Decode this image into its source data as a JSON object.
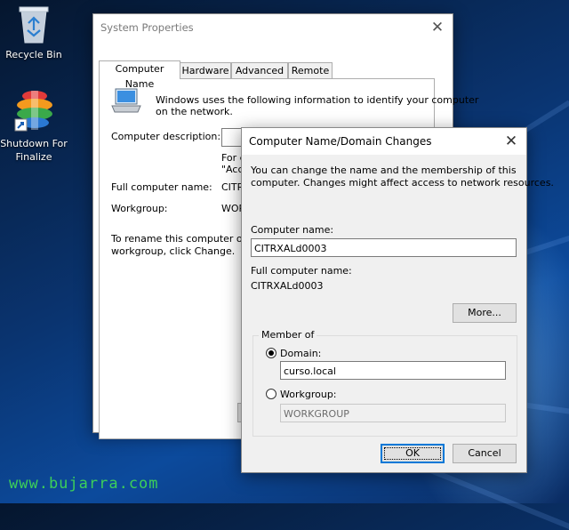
{
  "desktop": {
    "recycle_bin_label": "Recycle Bin",
    "shutdown_label_line1": "Shutdown For",
    "shutdown_label_line2": "Finalize",
    "watermark": "www.bujarra.com"
  },
  "system_properties": {
    "title": "System Properties",
    "tabs": [
      {
        "label": "Computer Name",
        "active": true
      },
      {
        "label": "Hardware",
        "active": false
      },
      {
        "label": "Advanced",
        "active": false
      },
      {
        "label": "Remote",
        "active": false
      }
    ],
    "intro_line1": "Windows uses the following information to identify your computer",
    "intro_line2": "on the network.",
    "description_label": "Computer description:",
    "example_line1": "For e",
    "example_line2": "\"Acc",
    "full_name_label": "Full computer name:",
    "full_name_value": "CITR",
    "workgroup_label": "Workgroup:",
    "workgroup_value": "WOR",
    "rename_line1": "To rename this computer or cha",
    "rename_line2": "workgroup, click Change."
  },
  "domain_changes": {
    "title": "Computer Name/Domain Changes",
    "intro_line1": "You can change the name and the membership of this",
    "intro_line2": "computer. Changes might affect access to network resources.",
    "computer_name_label": "Computer name:",
    "computer_name_value": "CITRXALd0003",
    "full_name_label": "Full computer name:",
    "full_name_value": "CITRXALd0003",
    "more_button": "More...",
    "member_of_label": "Member of",
    "domain_label": "Domain:",
    "domain_value": "curso.local",
    "domain_selected": true,
    "workgroup_label": "Workgroup:",
    "workgroup_value": "WORKGROUP",
    "ok_button": "OK",
    "cancel_button": "Cancel"
  }
}
